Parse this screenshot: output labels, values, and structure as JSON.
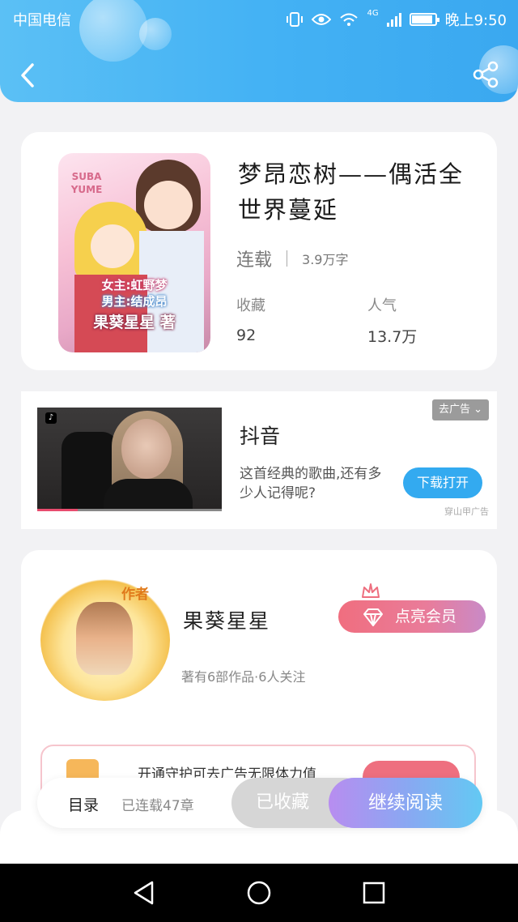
{
  "status_bar": {
    "carrier": "中国电信",
    "network": "4G",
    "time": "晚上9:50"
  },
  "header": {
    "back_icon": "chevron-left-icon",
    "share_icon": "share-icon"
  },
  "book": {
    "cover_texts": [
      "SUBA",
      "YUME",
      "女主:虹野梦",
      "男主:结成昂",
      "果葵星星 著"
    ],
    "title": "梦昂恋树——偶活全世界蔓延",
    "status": "连载",
    "words": "3.9万字",
    "stats": [
      {
        "label": "收藏",
        "value": "92"
      },
      {
        "label": "人气",
        "value": "13.7万"
      }
    ]
  },
  "ad": {
    "badge": "抖音",
    "title": "抖音",
    "description": "这首经典的歌曲,还有多少人记得呢?",
    "close_label": "去广告",
    "cta": "下载打开",
    "source": "穿山甲广告",
    "video_progress": 0.22
  },
  "author": {
    "name": "果葵星星",
    "subtitle": "著有6部作品·6人关注",
    "avatar_tag": "作者",
    "vip_label": "点亮会员"
  },
  "promo": {
    "text": "开通守护可去广告无限体力值"
  },
  "action_bar": {
    "toc_label": "目录",
    "toc_count": "已连载47章",
    "collected_label": "已收藏",
    "read_label": "继续阅读"
  },
  "battery_level": 0.9,
  "colors": {
    "header": "#44b2f4",
    "accent_blue": "#33aaf0",
    "vip_pink": "#f06e7f"
  }
}
